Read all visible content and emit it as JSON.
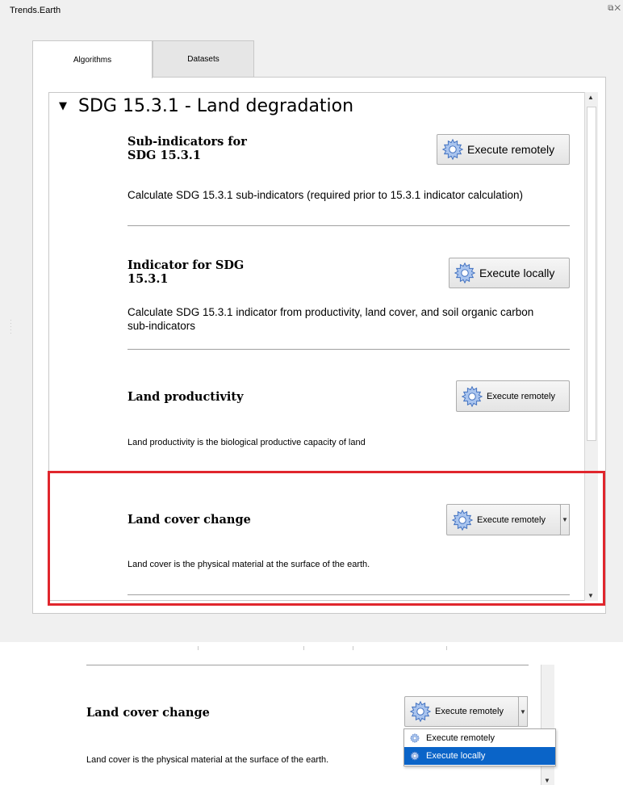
{
  "window": {
    "title": "Trends.Earth",
    "title_icons": "⧉✕"
  },
  "tabs": [
    {
      "label": "Algorithms",
      "active": true
    },
    {
      "label": "Datasets",
      "active": false
    }
  ],
  "group": {
    "title": "SDG 15.3.1 - Land degradation",
    "expand_icon": "triangle-down-icon"
  },
  "algorithms": [
    {
      "title": "Sub-indicators for SDG 15.3.1",
      "title_line1": "Sub-indicators for",
      "title_line2": "SDG 15.3.1",
      "description": "Calculate SDG 15.3.1 sub-indicators (required prior to 15.3.1 indicator calculation)",
      "button": "Execute remotely"
    },
    {
      "title": "Indicator for SDG 15.3.1",
      "title_line1": "Indicator for SDG",
      "title_line2": "15.3.1",
      "description_line1": "Calculate SDG 15.3.1 indicator from productivity, land cover, and soil organic carbon",
      "description_line2": "sub-indicators",
      "button": "Execute locally"
    },
    {
      "title": "Land productivity",
      "description": "Land productivity is the biological productive capacity of land",
      "button": "Execute remotely"
    },
    {
      "title": "Land cover change",
      "description": "Land cover is the physical material at the surface of the earth.",
      "button": "Execute remotely"
    }
  ],
  "zoom": {
    "title": "Land cover change",
    "description": "Land cover is the physical material at the surface of the earth.",
    "button": "Execute remotely",
    "menu": [
      {
        "label": "Execute remotely",
        "selected": false
      },
      {
        "label": "Execute locally",
        "selected": true
      }
    ]
  },
  "colors": {
    "highlight": "#e0262d",
    "menu_selected": "#0a64c8",
    "gear": "#4a78c8"
  }
}
